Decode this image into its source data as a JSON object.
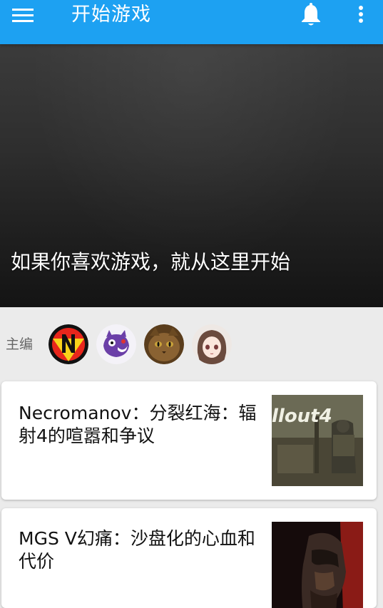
{
  "app_bar": {
    "title": "开始游戏",
    "menu_icon": "menu-icon",
    "notifications_icon": "bell-icon",
    "overflow_icon": "more-vert-icon",
    "background_color": "#1da1f2"
  },
  "hero": {
    "caption": "如果你喜欢游戏，就从这里开始"
  },
  "editors": {
    "label": "主编",
    "avatars": [
      "avatar-n-logo",
      "avatar-purple-creature",
      "avatar-cat",
      "avatar-anime-girl"
    ]
  },
  "articles": [
    {
      "title": "Necromanov：分裂红海：辐射4的喧嚣和争议",
      "thumbnail": "fallout-4-thumbnail"
    },
    {
      "title": "MGS V幻痛：沙盘化的心血和代价",
      "thumbnail": "mgs-v-thumbnail"
    }
  ]
}
